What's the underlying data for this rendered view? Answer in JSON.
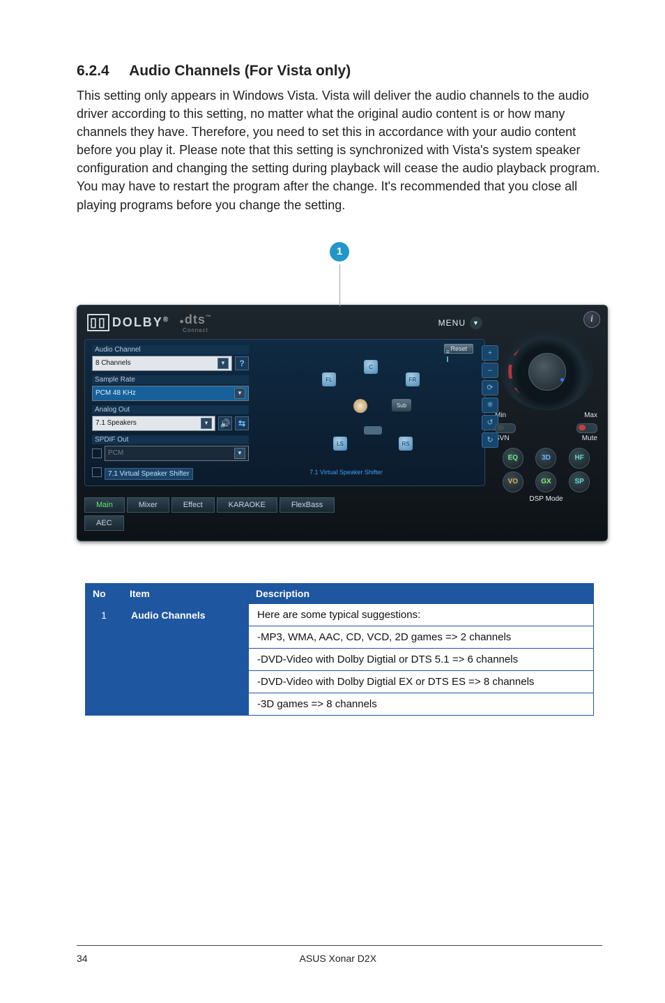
{
  "section": {
    "number": "6.2.4",
    "title": "Audio Channels (For Vista only)"
  },
  "paragraph": "This setting only appears in Windows Vista. Vista will deliver the audio channels to the audio driver according to this setting, no matter what the original audio content is or how many channels they have. Therefore, you need to set this in accordance with your audio content before you play it. Please note that this setting is synchronized with Vista's system speaker configuration and changing the setting during playback will cease the audio playback program. You may have to restart the program after the change. It's recommended that you close all playing programs before you change the setting.",
  "callout": "1",
  "panel": {
    "brand1": "DOLBY",
    "brand2": "dts",
    "brand2_caption": "Connect",
    "menu": "MENU",
    "reset": "Reset",
    "groups": {
      "audio_channel": {
        "label": "Audio Channel",
        "value": "8 Channels"
      },
      "sample_rate": {
        "label": "Sample Rate",
        "value": "PCM 48 KHz"
      },
      "analog_out": {
        "label": "Analog Out",
        "value": "7.1 Speakers"
      },
      "spdif_out": {
        "label": "SPDIF Out",
        "value": "PCM"
      },
      "vss": {
        "label": "7.1 Virtual Speaker Shifter"
      }
    },
    "stage": {
      "caption": "7.1 Virtual Speaker Shifter",
      "speakers": {
        "fl": "FL",
        "c": "C",
        "fr": "FR",
        "sub": "Sub",
        "ls": "LS",
        "rs": "RS"
      }
    },
    "side_icons": [
      "+",
      "–",
      "⟳",
      "⎈",
      "↺",
      "↻"
    ],
    "tabs_row1": [
      "Main",
      "Mixer",
      "Effect",
      "KARAOKE",
      "FlexBass"
    ],
    "tabs_row2": [
      "AEC"
    ],
    "right": {
      "min": "Min",
      "max": "Max",
      "svn": "SVN",
      "mute": "Mute",
      "dsp": "DSP Mode",
      "chips": [
        "EQ",
        "3D",
        "HF",
        "VO",
        "GX",
        "SP"
      ]
    }
  },
  "table": {
    "headers": {
      "no": "No",
      "item": "Item",
      "desc": "Description"
    },
    "row": {
      "no": "1",
      "item": "Audio Channels",
      "lines": [
        "Here are some typical suggestions:",
        "-MP3, WMA, AAC, CD, VCD, 2D games => 2 channels",
        "-DVD-Video with Dolby Digtial or DTS 5.1 => 6 channels",
        "-DVD-Video with Dolby Digtial EX or DTS ES => 8 channels",
        "-3D games => 8 channels"
      ]
    }
  },
  "footer": {
    "page": "34",
    "product": "ASUS Xonar D2X"
  }
}
